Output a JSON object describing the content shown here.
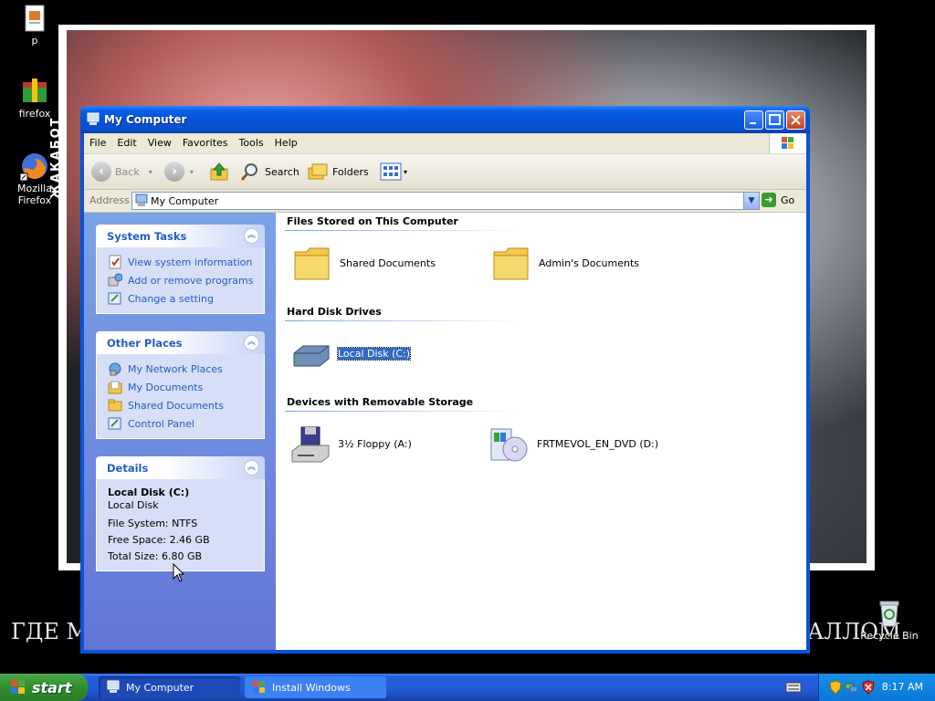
{
  "desktop": {
    "icons": [
      {
        "label": "p",
        "icon": "file-icon"
      },
      {
        "label": "firefox",
        "icon": "installer-icon"
      },
      {
        "label": "Mozilla Firefox",
        "icon": "firefox-icon"
      },
      {
        "label": "Recycle Bin",
        "icon": "recycle-bin-icon"
      }
    ],
    "vertical_text": "ЖАКАБОТ",
    "banner_left": "ГДЕ М",
    "banner_right": "АЛЛОМ"
  },
  "window": {
    "title": "My Computer",
    "menu": [
      "File",
      "Edit",
      "View",
      "Favorites",
      "Tools",
      "Help"
    ],
    "toolbar": {
      "back": "Back",
      "search": "Search",
      "folders": "Folders"
    },
    "address": {
      "label": "Address",
      "value": "My Computer",
      "go": "Go"
    },
    "left_pane": {
      "system_tasks": {
        "title": "System Tasks",
        "items": [
          "View system information",
          "Add or remove programs",
          "Change a setting"
        ]
      },
      "other_places": {
        "title": "Other Places",
        "items": [
          "My Network Places",
          "My Documents",
          "Shared Documents",
          "Control Panel"
        ]
      },
      "details": {
        "title": "Details",
        "name": "Local Disk (C:)",
        "type": "Local Disk",
        "file_system": "File System: NTFS",
        "free_space": "Free Space: 2.46 GB",
        "total_size": "Total Size: 6.80 GB"
      }
    },
    "content": {
      "groups": [
        {
          "title": "Files Stored on This Computer",
          "items": [
            "Shared Documents",
            "Admin's Documents"
          ]
        },
        {
          "title": "Hard Disk Drives",
          "items": [
            "Local Disk (C:)"
          ]
        },
        {
          "title": "Devices with Removable Storage",
          "items": [
            "3½ Floppy (A:)",
            "FRTMEVOL_EN_DVD (D:)"
          ]
        }
      ]
    }
  },
  "taskbar": {
    "start": "start",
    "tasks": [
      "My Computer",
      "Install Windows"
    ],
    "clock": "8:17 AM"
  },
  "colors": {
    "title_blue": "#0553d8",
    "link_blue": "#215dc6",
    "start_green": "#2f8e2c",
    "selection": "#316ac5"
  }
}
